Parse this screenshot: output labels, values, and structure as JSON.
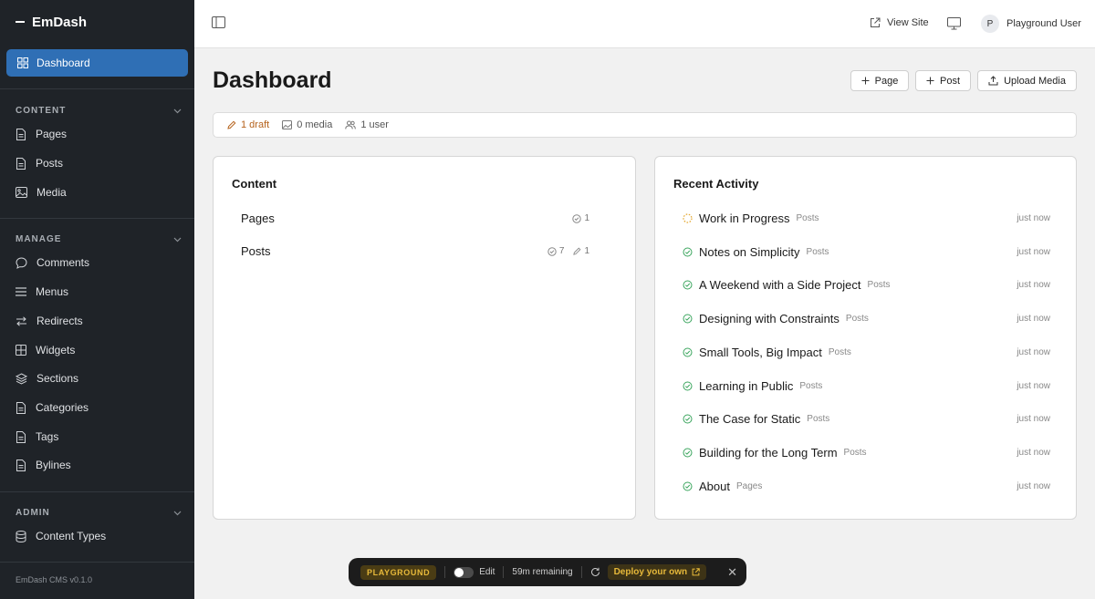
{
  "brand": {
    "name": "EmDash"
  },
  "sidebar": {
    "active": "Dashboard",
    "sections": {
      "content": {
        "title": "CONTENT",
        "items": [
          "Pages",
          "Posts",
          "Media"
        ]
      },
      "manage": {
        "title": "MANAGE",
        "items": [
          "Comments",
          "Menus",
          "Redirects",
          "Widgets",
          "Sections",
          "Categories",
          "Tags",
          "Bylines"
        ]
      },
      "admin": {
        "title": "ADMIN",
        "items": [
          "Content Types"
        ]
      }
    },
    "version": "EmDash CMS v0.1.0"
  },
  "topbar": {
    "view_site": "View Site",
    "user_initial": "P",
    "user_name": "Playground User"
  },
  "main": {
    "title": "Dashboard",
    "buttons": {
      "page": "Page",
      "post": "Post",
      "upload": "Upload Media"
    },
    "stats": {
      "drafts": "1 draft",
      "media": "0 media",
      "users": "1 user"
    }
  },
  "content_card": {
    "title": "Content",
    "rows": [
      {
        "label": "Pages",
        "published": "1",
        "drafts": ""
      },
      {
        "label": "Posts",
        "published": "7",
        "drafts": "1"
      }
    ]
  },
  "activity_card": {
    "title": "Recent Activity",
    "items": [
      {
        "title": "Work in Progress",
        "type": "Posts",
        "time": "just now",
        "status": "draft"
      },
      {
        "title": "Notes on Simplicity",
        "type": "Posts",
        "time": "just now",
        "status": "published"
      },
      {
        "title": "A Weekend with a Side Project",
        "type": "Posts",
        "time": "just now",
        "status": "published"
      },
      {
        "title": "Designing with Constraints",
        "type": "Posts",
        "time": "just now",
        "status": "published"
      },
      {
        "title": "Small Tools, Big Impact",
        "type": "Posts",
        "time": "just now",
        "status": "published"
      },
      {
        "title": "Learning in Public",
        "type": "Posts",
        "time": "just now",
        "status": "published"
      },
      {
        "title": "The Case for Static",
        "type": "Posts",
        "time": "just now",
        "status": "published"
      },
      {
        "title": "Building for the Long Term",
        "type": "Posts",
        "time": "just now",
        "status": "published"
      },
      {
        "title": "About",
        "type": "Pages",
        "time": "just now",
        "status": "published"
      }
    ]
  },
  "playground": {
    "badge": "PLAYGROUND",
    "edit": "Edit",
    "remaining": "59m remaining",
    "deploy": "Deploy your own"
  },
  "colors": {
    "sidebar_bg": "#1f2328",
    "accent": "#2f6fb5",
    "draft": "#b5621c",
    "published_check": "#3aa55d",
    "draft_dot": "#e3a52b"
  }
}
